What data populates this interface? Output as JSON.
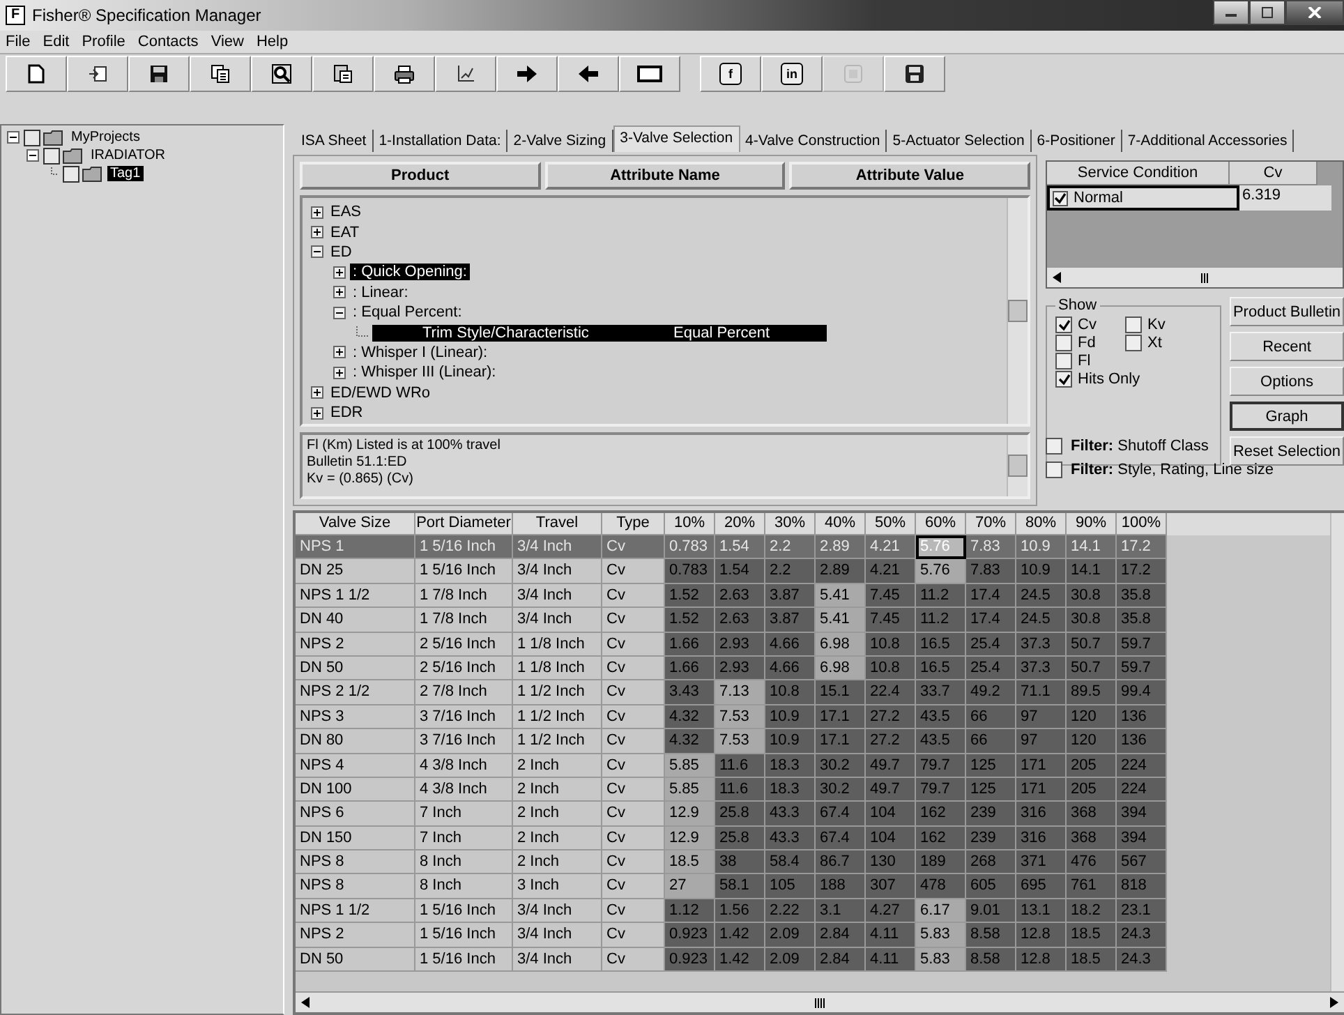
{
  "window": {
    "title": "Fisher® Specification Manager",
    "app_glyph": "F"
  },
  "menu": [
    "File",
    "Edit",
    "Profile",
    "Contacts",
    "View",
    "Help"
  ],
  "toolbar": [
    {
      "kind": "new",
      "disabled": false
    },
    {
      "kind": "import",
      "disabled": false
    },
    {
      "kind": "save",
      "disabled": false
    },
    {
      "kind": "copy",
      "disabled": false
    },
    {
      "kind": "find",
      "disabled": false
    },
    {
      "kind": "paste",
      "disabled": false
    },
    {
      "kind": "print",
      "disabled": false
    },
    {
      "kind": "chart",
      "disabled": false
    },
    {
      "kind": "forward",
      "disabled": false
    },
    {
      "kind": "back",
      "disabled": false
    },
    {
      "kind": "window",
      "disabled": false
    },
    {
      "kind": "social",
      "glyph": "f",
      "disabled": false
    },
    {
      "kind": "social",
      "glyph": "in",
      "disabled": false
    },
    {
      "kind": "blank",
      "disabled": true
    },
    {
      "kind": "disk",
      "disabled": false
    }
  ],
  "project_tree": [
    {
      "label": "MyProjects",
      "checked": false,
      "selected": false,
      "expanded": true,
      "children": [
        {
          "label": "IRADIATOR",
          "checked": false,
          "selected": false,
          "expanded": true,
          "children": [
            {
              "label": "Tag1",
              "checked": false,
              "selected": true
            }
          ]
        }
      ]
    }
  ],
  "tabs": [
    {
      "label": "ISA Sheet",
      "selected": false
    },
    {
      "label": "1-Installation Data:",
      "selected": false
    },
    {
      "label": "2-Valve Sizing",
      "selected": false
    },
    {
      "label": "3-Valve Selection",
      "selected": true
    },
    {
      "label": "4-Valve Construction",
      "selected": false
    },
    {
      "label": "5-Actuator Selection",
      "selected": false
    },
    {
      "label": "6-Positioner",
      "selected": false
    },
    {
      "label": "7-Additional Accessories",
      "selected": false
    }
  ],
  "product_tree": {
    "columns": [
      "Product",
      "Attribute Name",
      "Attribute Value"
    ],
    "items": [
      {
        "label": "EAS",
        "expanded": false,
        "selected": false
      },
      {
        "label": "EAT",
        "expanded": false,
        "selected": false
      },
      {
        "label": "ED",
        "expanded": true,
        "selected": false,
        "children": [
          {
            "label": ": Quick Opening:",
            "expanded": false,
            "selected": true
          },
          {
            "label": ": Linear:",
            "expanded": false,
            "selected": false
          },
          {
            "label": ": Equal Percent:",
            "expanded": true,
            "selected": false,
            "children": [
              {
                "attribute": "Trim Style/Characteristic",
                "value": "Equal Percent",
                "selected": true
              }
            ]
          },
          {
            "label": ": Whisper I (Linear):",
            "expanded": false,
            "selected": false
          },
          {
            "label": ": Whisper III (Linear):",
            "expanded": false,
            "selected": false
          }
        ]
      },
      {
        "label": "ED/EWD WRo",
        "expanded": false,
        "selected": false
      },
      {
        "label": "EDR",
        "expanded": false,
        "selected": false
      }
    ]
  },
  "info_lines": [
    "Fl (Km) Listed is at 100% travel",
    "Bulletin 51.1:ED",
    "Kv = (0.865) (Cv)"
  ],
  "service_conditions": {
    "columns": [
      "Service Condition",
      "Cv"
    ],
    "rows": [
      {
        "checked": true,
        "name": "Normal",
        "cv": "6.319"
      }
    ]
  },
  "show": {
    "title": "Show",
    "options": [
      {
        "label": "Cv",
        "checked": true
      },
      {
        "label": "Kv",
        "checked": false
      },
      {
        "label": "Fd",
        "checked": false
      },
      {
        "label": "Xt",
        "checked": false
      },
      {
        "label": "Fl",
        "checked": false
      },
      {
        "label": "Hits Only",
        "checked": true
      }
    ]
  },
  "buttons": [
    {
      "label": "Product Bulletin",
      "default": false
    },
    {
      "label": "Recent",
      "default": false
    },
    {
      "label": "Options",
      "default": false
    },
    {
      "label": "Graph",
      "default": true
    },
    {
      "label": "Reset Selection",
      "default": false
    }
  ],
  "filters": [
    {
      "text": "**Filter:** Shutoff Class",
      "checked": false
    },
    {
      "text": "**Filter:** Style, Rating, Line size",
      "checked": false
    }
  ],
  "valve_table": {
    "columns": [
      "Valve Size",
      "Port Diameter",
      "Travel",
      "Type",
      "10%",
      "20%",
      "30%",
      "40%",
      "50%",
      "60%",
      "70%",
      "80%",
      "90%",
      "100%"
    ],
    "rows": [
      {
        "cells": [
          {
            "v": "NPS 1",
            "kind": "text"
          },
          {
            "v": "1 5/16 Inch",
            "kind": "text"
          },
          {
            "v": "3/4 Inch",
            "kind": "text"
          },
          {
            "v": "Cv",
            "kind": "text"
          },
          {
            "v": "0.783",
            "kind": "value",
            "shaded": true
          },
          {
            "v": "1.54",
            "kind": "value",
            "shaded": true
          },
          {
            "v": "2.2",
            "kind": "value",
            "shaded": true
          },
          {
            "v": "2.89",
            "kind": "value",
            "shaded": true
          },
          {
            "v": "4.21",
            "kind": "value",
            "shaded": true
          },
          {
            "v": "5.76",
            "kind": "value",
            "shaded": false
          },
          {
            "v": "7.83",
            "kind": "value",
            "shaded": true
          },
          {
            "v": "10.9",
            "kind": "value",
            "shaded": true
          },
          {
            "v": "14.1",
            "kind": "value",
            "shaded": true
          },
          {
            "v": "17.2",
            "kind": "value",
            "shaded": true
          }
        ],
        "selected": true
      },
      {
        "cells": [
          {
            "v": "DN 25",
            "kind": "text"
          },
          {
            "v": "1 5/16 Inch",
            "kind": "text"
          },
          {
            "v": "3/4 Inch",
            "kind": "text"
          },
          {
            "v": "Cv",
            "kind": "text"
          },
          {
            "v": "0.783",
            "kind": "value",
            "shaded": true
          },
          {
            "v": "1.54",
            "kind": "value",
            "shaded": true
          },
          {
            "v": "2.2",
            "kind": "value",
            "shaded": true
          },
          {
            "v": "2.89",
            "kind": "value",
            "shaded": true
          },
          {
            "v": "4.21",
            "kind": "value",
            "shaded": true
          },
          {
            "v": "5.76",
            "kind": "value",
            "shaded": false
          },
          {
            "v": "7.83",
            "kind": "value",
            "shaded": true
          },
          {
            "v": "10.9",
            "kind": "value",
            "shaded": true
          },
          {
            "v": "14.1",
            "kind": "value",
            "shaded": true
          },
          {
            "v": "17.2",
            "kind": "value",
            "shaded": true
          }
        ],
        "selected": false
      },
      {
        "cells": [
          {
            "v": "NPS 1 1/2",
            "kind": "text"
          },
          {
            "v": "1 7/8 Inch",
            "kind": "text"
          },
          {
            "v": "3/4 Inch",
            "kind": "text"
          },
          {
            "v": "Cv",
            "kind": "text"
          },
          {
            "v": "1.52",
            "kind": "value",
            "shaded": true
          },
          {
            "v": "2.63",
            "kind": "value",
            "shaded": true
          },
          {
            "v": "3.87",
            "kind": "value",
            "shaded": true
          },
          {
            "v": "5.41",
            "kind": "value",
            "shaded": false
          },
          {
            "v": "7.45",
            "kind": "value",
            "shaded": true
          },
          {
            "v": "11.2",
            "kind": "value",
            "shaded": true
          },
          {
            "v": "17.4",
            "kind": "value",
            "shaded": true
          },
          {
            "v": "24.5",
            "kind": "value",
            "shaded": true
          },
          {
            "v": "30.8",
            "kind": "value",
            "shaded": true
          },
          {
            "v": "35.8",
            "kind": "value",
            "shaded": true
          }
        ],
        "selected": false
      },
      {
        "cells": [
          {
            "v": "DN 40",
            "kind": "text"
          },
          {
            "v": "1 7/8 Inch",
            "kind": "text"
          },
          {
            "v": "3/4 Inch",
            "kind": "text"
          },
          {
            "v": "Cv",
            "kind": "text"
          },
          {
            "v": "1.52",
            "kind": "value",
            "shaded": true
          },
          {
            "v": "2.63",
            "kind": "value",
            "shaded": true
          },
          {
            "v": "3.87",
            "kind": "value",
            "shaded": true
          },
          {
            "v": "5.41",
            "kind": "value",
            "shaded": false
          },
          {
            "v": "7.45",
            "kind": "value",
            "shaded": true
          },
          {
            "v": "11.2",
            "kind": "value",
            "shaded": true
          },
          {
            "v": "17.4",
            "kind": "value",
            "shaded": true
          },
          {
            "v": "24.5",
            "kind": "value",
            "shaded": true
          },
          {
            "v": "30.8",
            "kind": "value",
            "shaded": true
          },
          {
            "v": "35.8",
            "kind": "value",
            "shaded": true
          }
        ],
        "selected": false
      },
      {
        "cells": [
          {
            "v": "NPS 2",
            "kind": "text"
          },
          {
            "v": "2 5/16 Inch",
            "kind": "text"
          },
          {
            "v": "1 1/8 Inch",
            "kind": "text"
          },
          {
            "v": "Cv",
            "kind": "text"
          },
          {
            "v": "1.66",
            "kind": "value",
            "shaded": true
          },
          {
            "v": "2.93",
            "kind": "value",
            "shaded": true
          },
          {
            "v": "4.66",
            "kind": "value",
            "shaded": true
          },
          {
            "v": "6.98",
            "kind": "value",
            "shaded": false
          },
          {
            "v": "10.8",
            "kind": "value",
            "shaded": true
          },
          {
            "v": "16.5",
            "kind": "value",
            "shaded": true
          },
          {
            "v": "25.4",
            "kind": "value",
            "shaded": true
          },
          {
            "v": "37.3",
            "kind": "value",
            "shaded": true
          },
          {
            "v": "50.7",
            "kind": "value",
            "shaded": true
          },
          {
            "v": "59.7",
            "kind": "value",
            "shaded": true
          }
        ],
        "selected": false
      },
      {
        "cells": [
          {
            "v": "DN 50",
            "kind": "text"
          },
          {
            "v": "2 5/16 Inch",
            "kind": "text"
          },
          {
            "v": "1 1/8 Inch",
            "kind": "text"
          },
          {
            "v": "Cv",
            "kind": "text"
          },
          {
            "v": "1.66",
            "kind": "value",
            "shaded": true
          },
          {
            "v": "2.93",
            "kind": "value",
            "shaded": true
          },
          {
            "v": "4.66",
            "kind": "value",
            "shaded": true
          },
          {
            "v": "6.98",
            "kind": "value",
            "shaded": false
          },
          {
            "v": "10.8",
            "kind": "value",
            "shaded": true
          },
          {
            "v": "16.5",
            "kind": "value",
            "shaded": true
          },
          {
            "v": "25.4",
            "kind": "value",
            "shaded": true
          },
          {
            "v": "37.3",
            "kind": "value",
            "shaded": true
          },
          {
            "v": "50.7",
            "kind": "value",
            "shaded": true
          },
          {
            "v": "59.7",
            "kind": "value",
            "shaded": true
          }
        ],
        "selected": false
      },
      {
        "cells": [
          {
            "v": "NPS 2 1/2",
            "kind": "text"
          },
          {
            "v": "2 7/8 Inch",
            "kind": "text"
          },
          {
            "v": "1 1/2 Inch",
            "kind": "text"
          },
          {
            "v": "Cv",
            "kind": "text"
          },
          {
            "v": "3.43",
            "kind": "value",
            "shaded": true
          },
          {
            "v": "7.13",
            "kind": "value",
            "shaded": false
          },
          {
            "v": "10.8",
            "kind": "value",
            "shaded": true
          },
          {
            "v": "15.1",
            "kind": "value",
            "shaded": true
          },
          {
            "v": "22.4",
            "kind": "value",
            "shaded": true
          },
          {
            "v": "33.7",
            "kind": "value",
            "shaded": true
          },
          {
            "v": "49.2",
            "kind": "value",
            "shaded": true
          },
          {
            "v": "71.1",
            "kind": "value",
            "shaded": true
          },
          {
            "v": "89.5",
            "kind": "value",
            "shaded": true
          },
          {
            "v": "99.4",
            "kind": "value",
            "shaded": true
          }
        ],
        "selected": false
      },
      {
        "cells": [
          {
            "v": "NPS 3",
            "kind": "text"
          },
          {
            "v": "3 7/16 Inch",
            "kind": "text"
          },
          {
            "v": "1 1/2 Inch",
            "kind": "text"
          },
          {
            "v": "Cv",
            "kind": "text"
          },
          {
            "v": "4.32",
            "kind": "value",
            "shaded": true
          },
          {
            "v": "7.53",
            "kind": "value",
            "shaded": false
          },
          {
            "v": "10.9",
            "kind": "value",
            "shaded": true
          },
          {
            "v": "17.1",
            "kind": "value",
            "shaded": true
          },
          {
            "v": "27.2",
            "kind": "value",
            "shaded": true
          },
          {
            "v": "43.5",
            "kind": "value",
            "shaded": true
          },
          {
            "v": "66",
            "kind": "value",
            "shaded": true
          },
          {
            "v": "97",
            "kind": "value",
            "shaded": true
          },
          {
            "v": "120",
            "kind": "value",
            "shaded": true
          },
          {
            "v": "136",
            "kind": "value",
            "shaded": true
          }
        ],
        "selected": false
      },
      {
        "cells": [
          {
            "v": "DN 80",
            "kind": "text"
          },
          {
            "v": "3 7/16 Inch",
            "kind": "text"
          },
          {
            "v": "1 1/2 Inch",
            "kind": "text"
          },
          {
            "v": "Cv",
            "kind": "text"
          },
          {
            "v": "4.32",
            "kind": "value",
            "shaded": true
          },
          {
            "v": "7.53",
            "kind": "value",
            "shaded": false
          },
          {
            "v": "10.9",
            "kind": "value",
            "shaded": true
          },
          {
            "v": "17.1",
            "kind": "value",
            "shaded": true
          },
          {
            "v": "27.2",
            "kind": "value",
            "shaded": true
          },
          {
            "v": "43.5",
            "kind": "value",
            "shaded": true
          },
          {
            "v": "66",
            "kind": "value",
            "shaded": true
          },
          {
            "v": "97",
            "kind": "value",
            "shaded": true
          },
          {
            "v": "120",
            "kind": "value",
            "shaded": true
          },
          {
            "v": "136",
            "kind": "value",
            "shaded": true
          }
        ],
        "selected": false
      },
      {
        "cells": [
          {
            "v": "NPS 4",
            "kind": "text"
          },
          {
            "v": "4 3/8 Inch",
            "kind": "text"
          },
          {
            "v": "2 Inch",
            "kind": "text"
          },
          {
            "v": "Cv",
            "kind": "text"
          },
          {
            "v": "5.85",
            "kind": "value",
            "shaded": false
          },
          {
            "v": "11.6",
            "kind": "value",
            "shaded": true
          },
          {
            "v": "18.3",
            "kind": "value",
            "shaded": true
          },
          {
            "v": "30.2",
            "kind": "value",
            "shaded": true
          },
          {
            "v": "49.7",
            "kind": "value",
            "shaded": true
          },
          {
            "v": "79.7",
            "kind": "value",
            "shaded": true
          },
          {
            "v": "125",
            "kind": "value",
            "shaded": true
          },
          {
            "v": "171",
            "kind": "value",
            "shaded": true
          },
          {
            "v": "205",
            "kind": "value",
            "shaded": true
          },
          {
            "v": "224",
            "kind": "value",
            "shaded": true
          }
        ],
        "selected": false
      },
      {
        "cells": [
          {
            "v": "DN 100",
            "kind": "text"
          },
          {
            "v": "4 3/8 Inch",
            "kind": "text"
          },
          {
            "v": "2 Inch",
            "kind": "text"
          },
          {
            "v": "Cv",
            "kind": "text"
          },
          {
            "v": "5.85",
            "kind": "value",
            "shaded": false
          },
          {
            "v": "11.6",
            "kind": "value",
            "shaded": true
          },
          {
            "v": "18.3",
            "kind": "value",
            "shaded": true
          },
          {
            "v": "30.2",
            "kind": "value",
            "shaded": true
          },
          {
            "v": "49.7",
            "kind": "value",
            "shaded": true
          },
          {
            "v": "79.7",
            "kind": "value",
            "shaded": true
          },
          {
            "v": "125",
            "kind": "value",
            "shaded": true
          },
          {
            "v": "171",
            "kind": "value",
            "shaded": true
          },
          {
            "v": "205",
            "kind": "value",
            "shaded": true
          },
          {
            "v": "224",
            "kind": "value",
            "shaded": true
          }
        ],
        "selected": false
      },
      {
        "cells": [
          {
            "v": "NPS 6",
            "kind": "text"
          },
          {
            "v": "7 Inch",
            "kind": "text"
          },
          {
            "v": "2 Inch",
            "kind": "text"
          },
          {
            "v": "Cv",
            "kind": "text"
          },
          {
            "v": "12.9",
            "kind": "value",
            "shaded": false
          },
          {
            "v": "25.8",
            "kind": "value",
            "shaded": true
          },
          {
            "v": "43.3",
            "kind": "value",
            "shaded": true
          },
          {
            "v": "67.4",
            "kind": "value",
            "shaded": true
          },
          {
            "v": "104",
            "kind": "value",
            "shaded": true
          },
          {
            "v": "162",
            "kind": "value",
            "shaded": true
          },
          {
            "v": "239",
            "kind": "value",
            "shaded": true
          },
          {
            "v": "316",
            "kind": "value",
            "shaded": true
          },
          {
            "v": "368",
            "kind": "value",
            "shaded": true
          },
          {
            "v": "394",
            "kind": "value",
            "shaded": true
          }
        ],
        "selected": false
      },
      {
        "cells": [
          {
            "v": "DN 150",
            "kind": "text"
          },
          {
            "v": "7 Inch",
            "kind": "text"
          },
          {
            "v": "2 Inch",
            "kind": "text"
          },
          {
            "v": "Cv",
            "kind": "text"
          },
          {
            "v": "12.9",
            "kind": "value",
            "shaded": false
          },
          {
            "v": "25.8",
            "kind": "value",
            "shaded": true
          },
          {
            "v": "43.3",
            "kind": "value",
            "shaded": true
          },
          {
            "v": "67.4",
            "kind": "value",
            "shaded": true
          },
          {
            "v": "104",
            "kind": "value",
            "shaded": true
          },
          {
            "v": "162",
            "kind": "value",
            "shaded": true
          },
          {
            "v": "239",
            "kind": "value",
            "shaded": true
          },
          {
            "v": "316",
            "kind": "value",
            "shaded": true
          },
          {
            "v": "368",
            "kind": "value",
            "shaded": true
          },
          {
            "v": "394",
            "kind": "value",
            "shaded": true
          }
        ],
        "selected": false
      },
      {
        "cells": [
          {
            "v": "NPS 8",
            "kind": "text"
          },
          {
            "v": "8 Inch",
            "kind": "text"
          },
          {
            "v": "2 Inch",
            "kind": "text"
          },
          {
            "v": "Cv",
            "kind": "text"
          },
          {
            "v": "18.5",
            "kind": "value",
            "shaded": false
          },
          {
            "v": "38",
            "kind": "value",
            "shaded": true
          },
          {
            "v": "58.4",
            "kind": "value",
            "shaded": true
          },
          {
            "v": "86.7",
            "kind": "value",
            "shaded": true
          },
          {
            "v": "130",
            "kind": "value",
            "shaded": true
          },
          {
            "v": "189",
            "kind": "value",
            "shaded": true
          },
          {
            "v": "268",
            "kind": "value",
            "shaded": true
          },
          {
            "v": "371",
            "kind": "value",
            "shaded": true
          },
          {
            "v": "476",
            "kind": "value",
            "shaded": true
          },
          {
            "v": "567",
            "kind": "value",
            "shaded": true
          }
        ],
        "selected": false
      },
      {
        "cells": [
          {
            "v": "NPS 8",
            "kind": "text"
          },
          {
            "v": "8 Inch",
            "kind": "text"
          },
          {
            "v": "3 Inch",
            "kind": "text"
          },
          {
            "v": "Cv",
            "kind": "text"
          },
          {
            "v": "27",
            "kind": "value",
            "shaded": false
          },
          {
            "v": "58.1",
            "kind": "value",
            "shaded": true
          },
          {
            "v": "105",
            "kind": "value",
            "shaded": true
          },
          {
            "v": "188",
            "kind": "value",
            "shaded": true
          },
          {
            "v": "307",
            "kind": "value",
            "shaded": true
          },
          {
            "v": "478",
            "kind": "value",
            "shaded": true
          },
          {
            "v": "605",
            "kind": "value",
            "shaded": true
          },
          {
            "v": "695",
            "kind": "value",
            "shaded": true
          },
          {
            "v": "761",
            "kind": "value",
            "shaded": true
          },
          {
            "v": "818",
            "kind": "value",
            "shaded": true
          }
        ],
        "selected": false
      },
      {
        "cells": [
          {
            "v": "NPS 1 1/2",
            "kind": "text"
          },
          {
            "v": "1 5/16 Inch",
            "kind": "text"
          },
          {
            "v": "3/4 Inch",
            "kind": "text"
          },
          {
            "v": "Cv",
            "kind": "text"
          },
          {
            "v": "1.12",
            "kind": "value",
            "shaded": true
          },
          {
            "v": "1.56",
            "kind": "value",
            "shaded": true
          },
          {
            "v": "2.22",
            "kind": "value",
            "shaded": true
          },
          {
            "v": "3.1",
            "kind": "value",
            "shaded": true
          },
          {
            "v": "4.27",
            "kind": "value",
            "shaded": true
          },
          {
            "v": "6.17",
            "kind": "value",
            "shaded": false
          },
          {
            "v": "9.01",
            "kind": "value",
            "shaded": true
          },
          {
            "v": "13.1",
            "kind": "value",
            "shaded": true
          },
          {
            "v": "18.2",
            "kind": "value",
            "shaded": true
          },
          {
            "v": "23.1",
            "kind": "value",
            "shaded": true
          }
        ],
        "selected": false
      },
      {
        "cells": [
          {
            "v": "NPS 2",
            "kind": "text"
          },
          {
            "v": "1 5/16 Inch",
            "kind": "text"
          },
          {
            "v": "3/4 Inch",
            "kind": "text"
          },
          {
            "v": "Cv",
            "kind": "text"
          },
          {
            "v": "0.923",
            "kind": "value",
            "shaded": true
          },
          {
            "v": "1.42",
            "kind": "value",
            "shaded": true
          },
          {
            "v": "2.09",
            "kind": "value",
            "shaded": true
          },
          {
            "v": "2.84",
            "kind": "value",
            "shaded": true
          },
          {
            "v": "4.11",
            "kind": "value",
            "shaded": true
          },
          {
            "v": "5.83",
            "kind": "value",
            "shaded": false
          },
          {
            "v": "8.58",
            "kind": "value",
            "shaded": true
          },
          {
            "v": "12.8",
            "kind": "value",
            "shaded": true
          },
          {
            "v": "18.5",
            "kind": "value",
            "shaded": true
          },
          {
            "v": "24.3",
            "kind": "value",
            "shaded": true
          }
        ],
        "selected": false
      },
      {
        "cells": [
          {
            "v": "DN 50",
            "kind": "text"
          },
          {
            "v": "1 5/16 Inch",
            "kind": "text"
          },
          {
            "v": "3/4 Inch",
            "kind": "text"
          },
          {
            "v": "Cv",
            "kind": "text"
          },
          {
            "v": "0.923",
            "kind": "value",
            "shaded": true
          },
          {
            "v": "1.42",
            "kind": "value",
            "shaded": true
          },
          {
            "v": "2.09",
            "kind": "value",
            "shaded": true
          },
          {
            "v": "2.84",
            "kind": "value",
            "shaded": true
          },
          {
            "v": "4.11",
            "kind": "value",
            "shaded": true
          },
          {
            "v": "5.83",
            "kind": "value",
            "shaded": false
          },
          {
            "v": "8.58",
            "kind": "value",
            "shaded": true
          },
          {
            "v": "12.8",
            "kind": "value",
            "shaded": true
          },
          {
            "v": "18.5",
            "kind": "value",
            "shaded": true
          },
          {
            "v": "24.3",
            "kind": "value",
            "shaded": true
          }
        ],
        "selected": false
      }
    ]
  }
}
